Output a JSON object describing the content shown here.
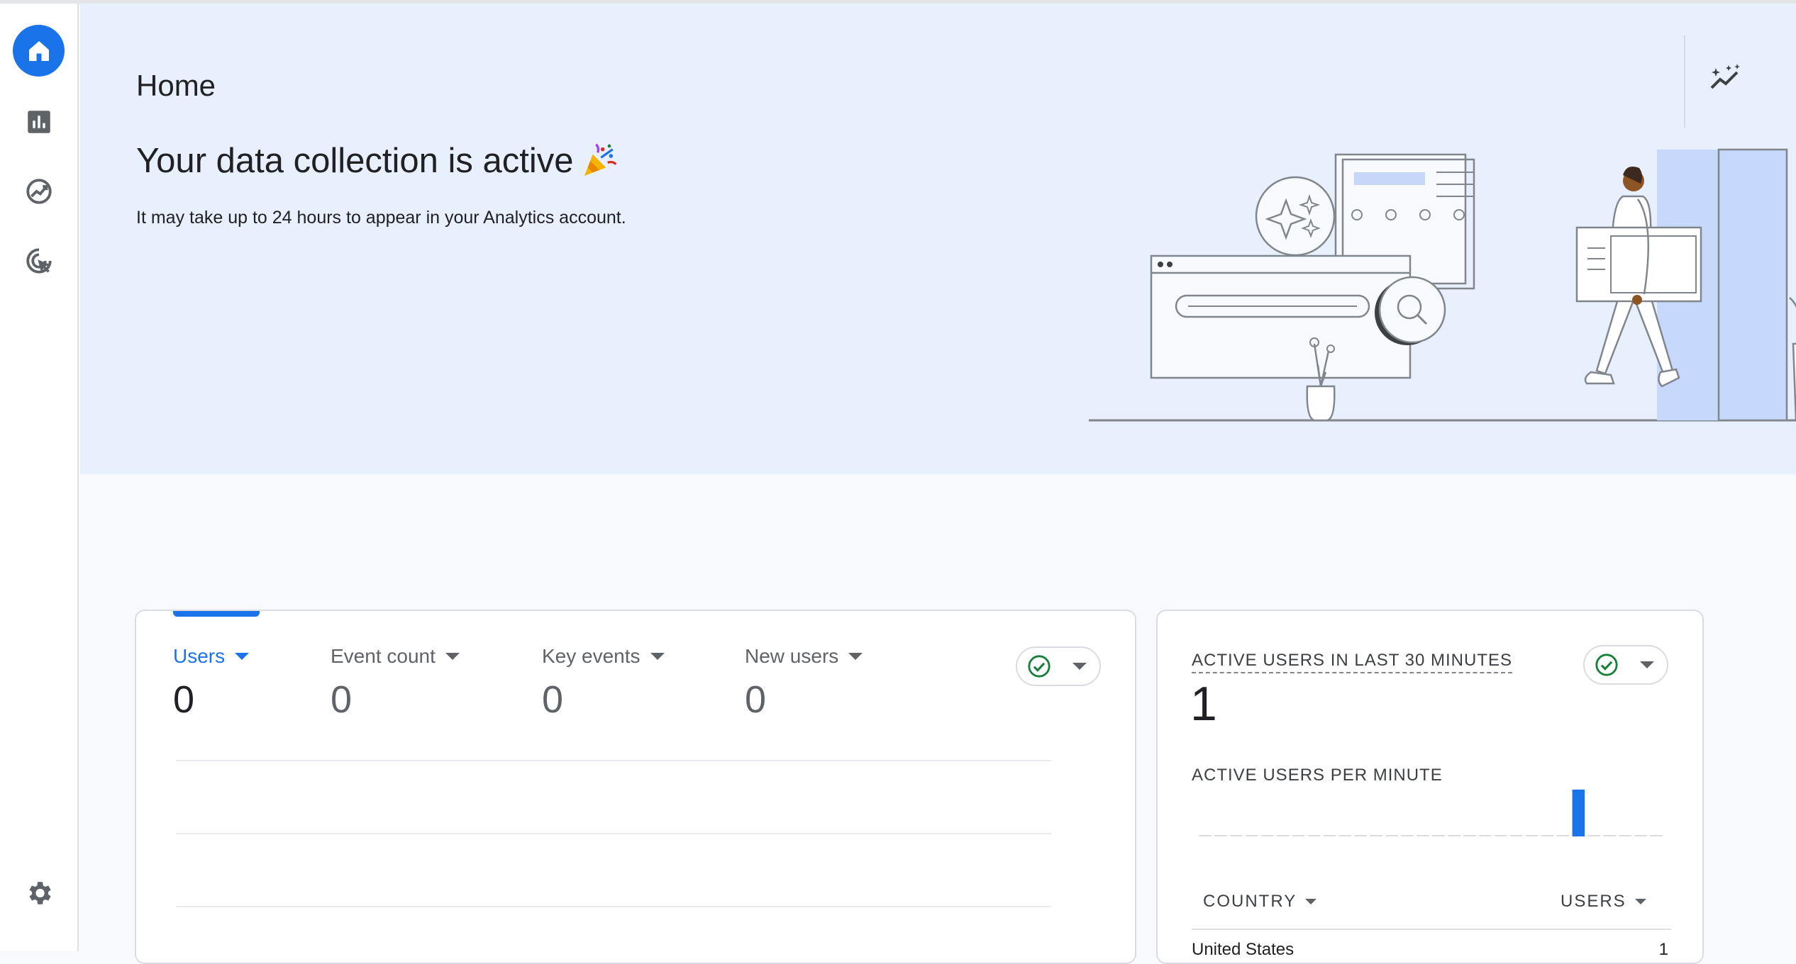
{
  "header": {
    "title": "Home"
  },
  "hero": {
    "heading": "Your data collection is active",
    "heading_emoji": "party-popper-icon",
    "subtext": "It may take up to 24 hours to appear in your Analytics account."
  },
  "nav": {
    "items": [
      {
        "icon": "home-icon",
        "active": true
      },
      {
        "icon": "bar-chart-icon",
        "active": false
      },
      {
        "icon": "explore-trend-icon",
        "active": false
      },
      {
        "icon": "advertising-target-icon",
        "active": false
      },
      {
        "icon": "gear-icon",
        "active": false
      }
    ]
  },
  "overview_card": {
    "metrics": [
      {
        "label": "Users",
        "value": "0",
        "active": true
      },
      {
        "label": "Event count",
        "value": "0",
        "active": false
      },
      {
        "label": "Key events",
        "value": "0",
        "active": false
      },
      {
        "label": "New users",
        "value": "0",
        "active": false
      }
    ],
    "status_icon": "check-circle-icon"
  },
  "realtime_card": {
    "title": "ACTIVE USERS IN LAST 30 MINUTES",
    "value": "1",
    "per_minute_label": "ACTIVE USERS PER MINUTE",
    "status_icon": "check-circle-icon",
    "table": {
      "columns": [
        "COUNTRY",
        "USERS"
      ],
      "rows": [
        {
          "country": "United States",
          "users": "1"
        }
      ]
    }
  },
  "chart_data": {
    "type": "bar",
    "title": "ACTIVE USERS PER MINUTE",
    "values": [
      0,
      0,
      0,
      0,
      0,
      0,
      0,
      0,
      0,
      0,
      0,
      0,
      0,
      0,
      0,
      0,
      0,
      0,
      0,
      0,
      0,
      0,
      0,
      0,
      1,
      0,
      0,
      0,
      0,
      0
    ],
    "highlight_index": 24
  },
  "colors": {
    "accent": "#1a73e8",
    "hero_bg": "#e8effd",
    "success": "#188038"
  }
}
